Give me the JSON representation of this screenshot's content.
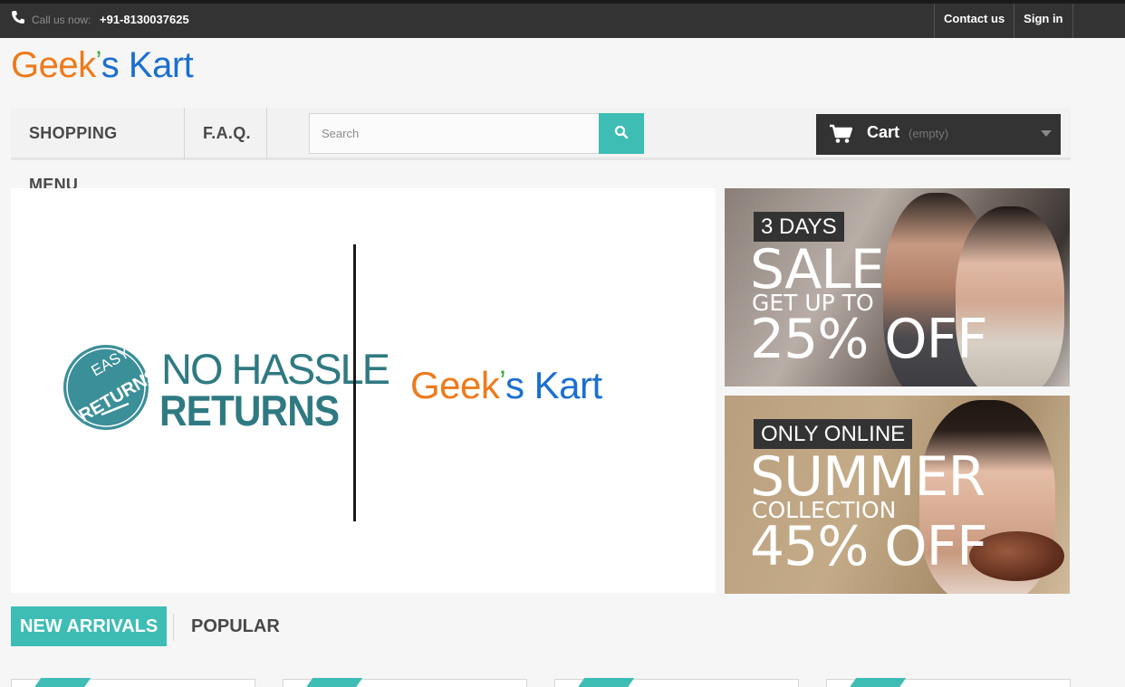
{
  "topbar": {
    "call_label": "Call us now:",
    "call_number": "+91-8130037625",
    "links": [
      "Contact us",
      "Sign in"
    ]
  },
  "logo": {
    "part1": "Geek",
    "apostrophe": "’",
    "part2": "s Kart"
  },
  "nav": {
    "menu": [
      "SHOPPING MENU",
      "F.A.Q."
    ],
    "search_placeholder": "Search",
    "cart_label": "Cart",
    "cart_status": "(empty)"
  },
  "main_banner": {
    "badge_line1": "EASY",
    "badge_line2": "RETURNS",
    "headline1": "NO HASSLE",
    "headline2": "RETURNS",
    "logo_part1": "Geek",
    "logo_apostrophe": "’",
    "logo_part2": "s Kart"
  },
  "side_banners": [
    {
      "tag": "3 DAYS",
      "big": "SALE",
      "small": "GET UP TO",
      "pct": "25% OFF"
    },
    {
      "tag": "ONLY ONLINE",
      "big": "SUMMER",
      "small": "COLLECTION",
      "pct": "45% OFF"
    }
  ],
  "tabs": [
    "NEW ARRIVALS",
    "POPULAR"
  ],
  "colors": {
    "accent": "#3ebdb5",
    "dark": "#333333",
    "logo_orange": "#ee7a1b",
    "logo_green": "#39a935",
    "logo_blue": "#1b6fd1",
    "returns_teal": "#2f7a82"
  },
  "icons": [
    "phone-icon",
    "search-icon",
    "cart-icon",
    "chevron-down-icon"
  ]
}
